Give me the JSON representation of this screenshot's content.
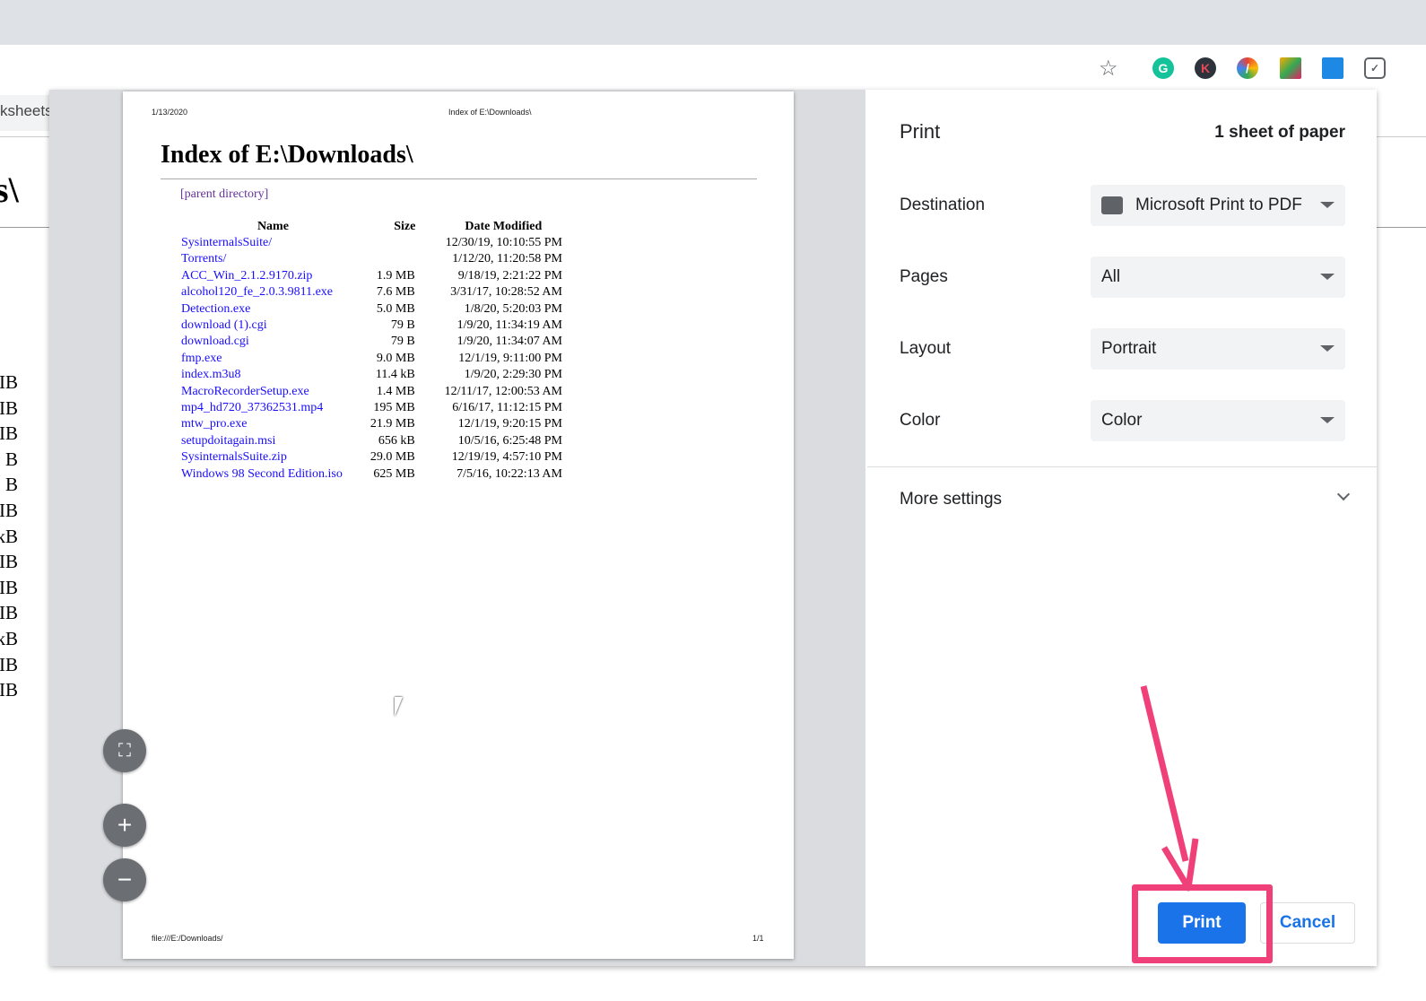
{
  "browser": {
    "extensions": [
      "grammarly-icon",
      "k-extension-icon",
      "color-picker-icon",
      "image-extension-icon",
      "window-extension-icon",
      "pocket-icon"
    ]
  },
  "background_page": {
    "tab_fragment": "ksheets",
    "title_fragment": "s\\",
    "size_fragments": [
      "IB",
      "IB",
      "IB",
      "B",
      "B",
      "IB",
      "kB",
      "IB",
      "IB",
      "IB",
      "kB",
      "IB",
      "IB"
    ]
  },
  "preview": {
    "header_date": "1/13/2020",
    "header_title": "Index of E:\\Downloads\\",
    "title": "Index of E:\\Downloads\\",
    "parent_link": "[parent directory]",
    "columns": [
      "Name",
      "Size",
      "Date Modified"
    ],
    "rows": [
      [
        "SysinternalsSuite/",
        "",
        "12/30/19, 10:10:55 PM"
      ],
      [
        "Torrents/",
        "",
        "1/12/20, 11:20:58 PM"
      ],
      [
        "ACC_Win_2.1.2.9170.zip",
        "1.9 MB",
        "9/18/19, 2:21:22 PM"
      ],
      [
        "alcohol120_fe_2.0.3.9811.exe",
        "7.6 MB",
        "3/31/17, 10:28:52 AM"
      ],
      [
        "Detection.exe",
        "5.0 MB",
        "1/8/20, 5:20:03 PM"
      ],
      [
        "download (1).cgi",
        "79 B",
        "1/9/20, 11:34:19 AM"
      ],
      [
        "download.cgi",
        "79 B",
        "1/9/20, 11:34:07 AM"
      ],
      [
        "fmp.exe",
        "9.0 MB",
        "12/1/19, 9:11:00 PM"
      ],
      [
        "index.m3u8",
        "11.4 kB",
        "1/9/20, 2:29:30 PM"
      ],
      [
        "MacroRecorderSetup.exe",
        "1.4 MB",
        "12/11/17, 12:00:53 AM"
      ],
      [
        "mp4_hd720_37362531.mp4",
        "195 MB",
        "6/16/17, 11:12:15 PM"
      ],
      [
        "mtw_pro.exe",
        "21.9 MB",
        "12/1/19, 9:20:15 PM"
      ],
      [
        "setupdoitagain.msi",
        "656 kB",
        "10/5/16, 6:25:48 PM"
      ],
      [
        "SysinternalsSuite.zip",
        "29.0 MB",
        "12/19/19, 4:57:10 PM"
      ],
      [
        "Windows 98 Second Edition.iso",
        "625 MB",
        "7/5/16, 10:22:13 AM"
      ]
    ],
    "footer_url": "file:///E:/Downloads/",
    "footer_page": "1/1"
  },
  "print": {
    "title": "Print",
    "sheets": "1 sheet of paper",
    "destination_label": "Destination",
    "destination": "Microsoft Print to PDF",
    "pages_label": "Pages",
    "pages": "All",
    "layout_label": "Layout",
    "layout": "Portrait",
    "color_label": "Color",
    "color": "Color",
    "more_settings": "More settings",
    "print_button": "Print",
    "cancel_button": "Cancel"
  },
  "colors": {
    "accent": "#1a73e8",
    "annotation": "#f0407a"
  }
}
